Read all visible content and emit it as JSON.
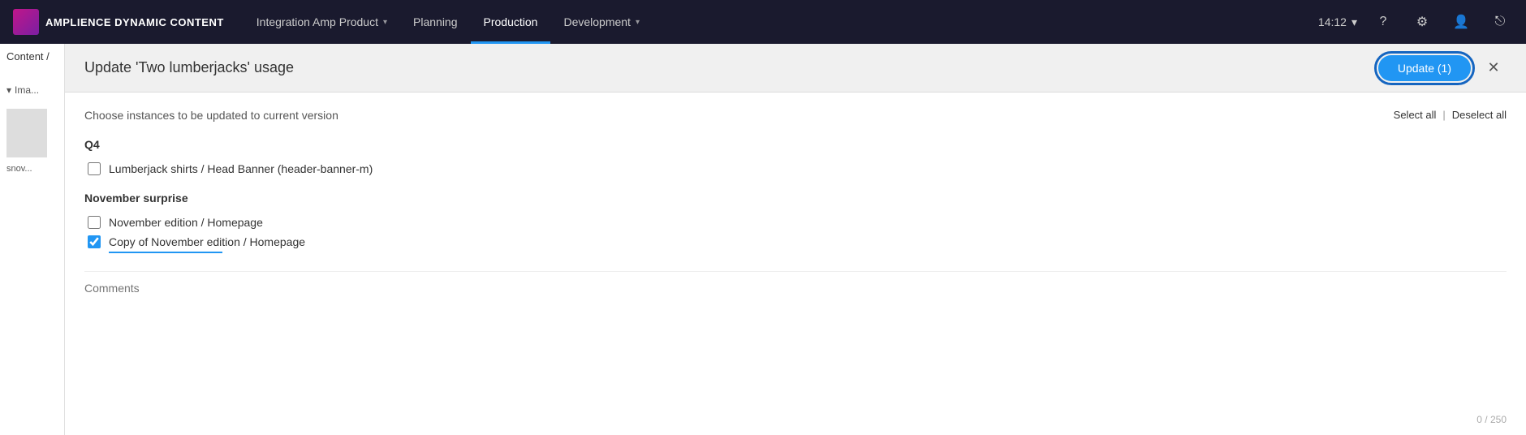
{
  "brand": {
    "name": "AMPLIENCE DYNAMIC CONTENT"
  },
  "nav": {
    "items": [
      {
        "label": "Integration Amp Product",
        "hasChevron": true,
        "active": false
      },
      {
        "label": "Planning",
        "hasChevron": false,
        "active": false
      },
      {
        "label": "Production",
        "hasChevron": false,
        "active": true
      },
      {
        "label": "Development",
        "hasChevron": true,
        "active": false
      }
    ],
    "time": "14:12",
    "chevron_down": "▾"
  },
  "dialog": {
    "title": "Update 'Two lumberjacks' usage",
    "subtitle": "Choose instances to be updated to current version",
    "update_button": "Update (1)",
    "close_icon": "✕",
    "select_all": "Select all",
    "deselect_all": "Deselect all",
    "separator": "|",
    "groups": [
      {
        "label": "Q4",
        "items": [
          {
            "label": "Lumberjack shirts / Head Banner (header-banner-m)",
            "checked": false
          }
        ]
      },
      {
        "label": "November surprise",
        "items": [
          {
            "label": "November edition / Homepage",
            "checked": false
          },
          {
            "label": "Copy of November edition / Homepage",
            "checked": true
          }
        ]
      }
    ],
    "comments_placeholder": "Comments",
    "char_count": "0 / 250"
  }
}
